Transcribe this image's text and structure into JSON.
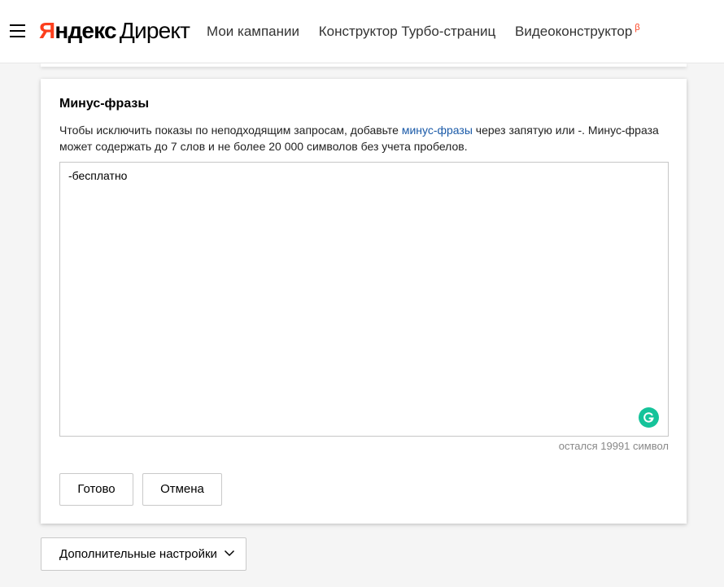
{
  "header": {
    "logo_brand_first": "Я",
    "logo_brand_rest": "ндекс",
    "logo_product": "Директ",
    "nav": [
      {
        "label": "Мои кампании"
      },
      {
        "label": "Конструктор Турбо-страниц"
      },
      {
        "label": "Видеоконструктор",
        "badge": "β"
      }
    ]
  },
  "card": {
    "title": "Минус-фразы",
    "desc_before": "Чтобы исключить показы по неподходящим запросам, добавьте ",
    "desc_link": "минус-фразы",
    "desc_after": " через запятую или -. Минус-фраза может содержать до 7 слов и не более 20 000 символов без учета пробелов.",
    "textarea_value": "-бесплатно",
    "counter": "остался 19991 символ",
    "done_label": "Готово",
    "cancel_label": "Отмена"
  },
  "more_settings": {
    "label": "Дополнительные настройки"
  },
  "icons": {
    "menu": "hamburger-menu-icon",
    "grammarly": "grammarly-icon",
    "chevron": "chevron-down-icon"
  },
  "colors": {
    "brand_red": "#fc3f1d",
    "link_blue": "#1a5aa8",
    "grammarly_green": "#15c39a"
  }
}
